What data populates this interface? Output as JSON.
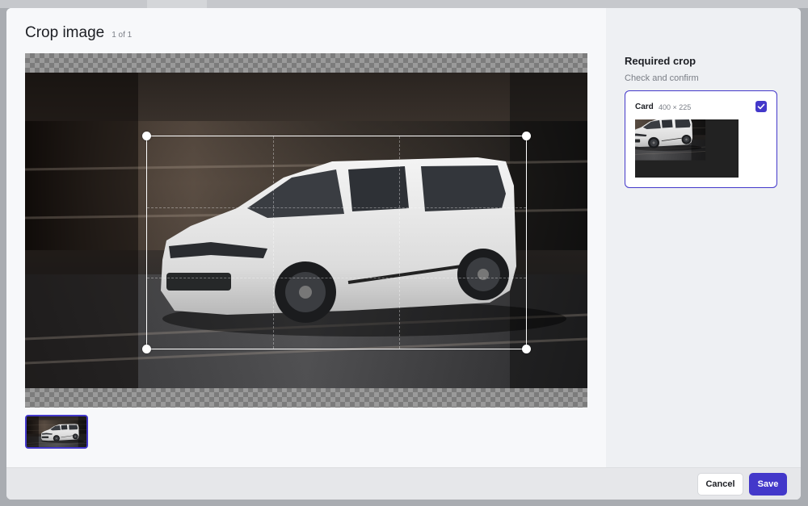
{
  "dialog": {
    "title": "Crop image",
    "counter": "1 of 1"
  },
  "side": {
    "title": "Required crop",
    "subtitle": "Check and confirm",
    "crops": [
      {
        "name": "Card",
        "dimensions": "400 × 225",
        "checked": true
      }
    ]
  },
  "footer": {
    "cancel_label": "Cancel",
    "save_label": "Save"
  },
  "colors": {
    "accent": "#4338ca",
    "modal_bg": "#f7f8fa",
    "side_bg": "#eef0f3"
  },
  "icons": {
    "check": "check-icon"
  }
}
